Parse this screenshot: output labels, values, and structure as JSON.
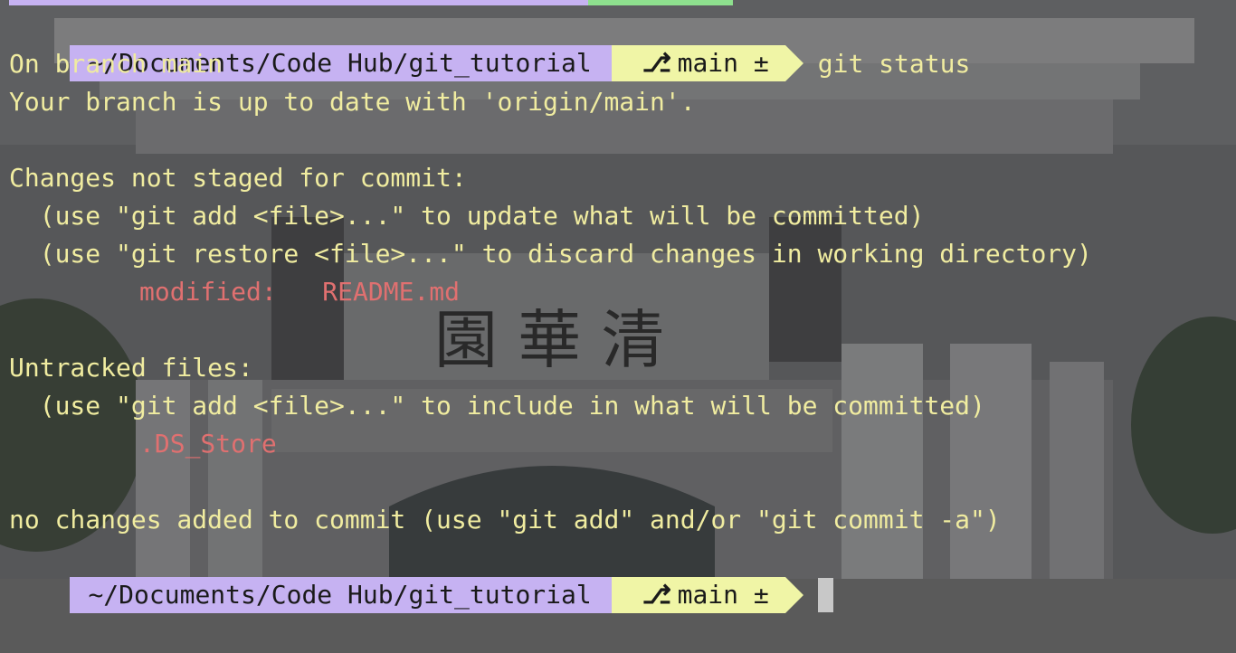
{
  "prompt": {
    "path": "~/Documents/Code Hub/git_tutorial",
    "branch_icon": "git-branch-icon",
    "branch": "main ±"
  },
  "command": "git status",
  "output": {
    "line1": "On branch main",
    "line2": "Your branch is up to date with 'origin/main'.",
    "line3": "",
    "line4": "Changes not staged for commit:",
    "line5": "  (use \"git add <file>...\" to update what will be committed)",
    "line6": "  (use \"git restore <file>...\" to discard changes in working directory)",
    "line7_label": "modified:   README.md",
    "line8": "",
    "line9": "Untracked files:",
    "line10": "  (use \"git add <file>...\" to include in what will be committed)",
    "line11_file": ".DS_Store",
    "line12": "",
    "line13": "no changes added to commit (use \"git add\" and/or \"git commit -a\")"
  },
  "colors": {
    "path_bg": "#c6b2f2",
    "branch_bg": "#f0f5a6",
    "text": "#f0eca0",
    "modified": "#e07070"
  }
}
